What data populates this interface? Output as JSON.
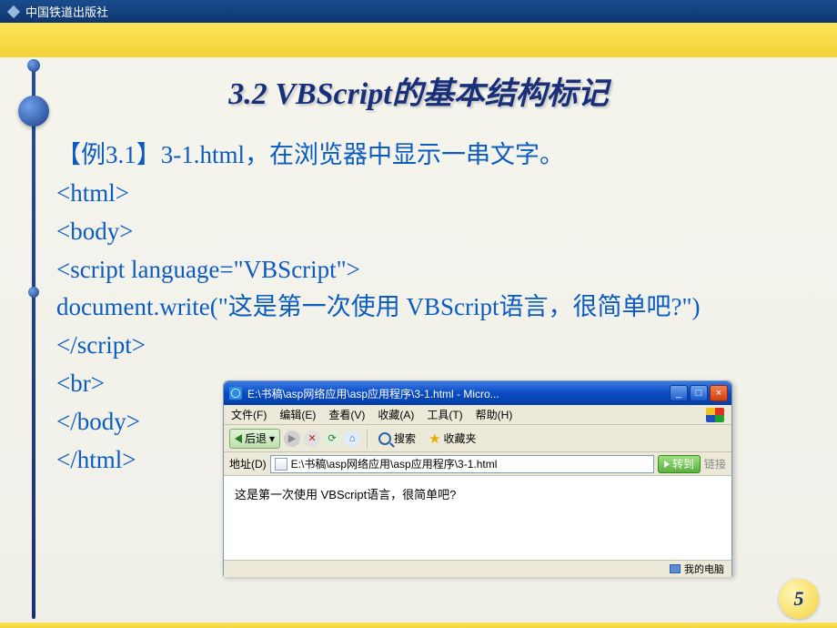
{
  "topbar": {
    "publisher": "中国铁道出版社"
  },
  "title": "3.2  VBScript的基本结构标记",
  "example": {
    "label": "【例3.1】",
    "desc": "3-1.html，在浏览器中显示一串文字。"
  },
  "code": {
    "l1": "<html>",
    "l2": "<body>",
    "l3": "<script language=\"VBScript\">",
    "l4": "document.write(\"这是第一次使用 VBScript语言，很简单吧?\")",
    "l5": "</script>",
    "l6": "<br>",
    "l7": "</body>",
    "l8": "</html>"
  },
  "browser": {
    "title": "E:\\书稿\\asp网络应用\\asp应用程序\\3-1.html - Micro...",
    "menu": {
      "file": "文件(F)",
      "edit": "编辑(E)",
      "view": "查看(V)",
      "fav": "收藏(A)",
      "tools": "工具(T)",
      "help": "帮助(H)"
    },
    "toolbar": {
      "back": "后退",
      "search": "搜索",
      "favorites": "收藏夹"
    },
    "addr_label": "地址(D)",
    "addr_value": "E:\\书稿\\asp网络应用\\asp应用程序\\3-1.html",
    "go": "转到",
    "links": "链接",
    "body_text": "这是第一次使用 VBScript语言，很简单吧?",
    "status_zone": "我的电脑"
  },
  "page_number": "5"
}
